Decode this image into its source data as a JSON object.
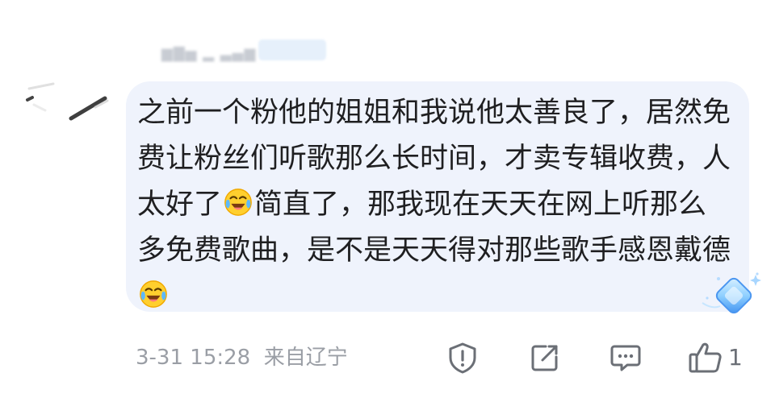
{
  "comment": {
    "text_before_emoji": "之前一个粉他的姐姐和我说他太善良了，居然免费让粉丝们听歌那么长时间，才卖专辑收费，人太好了",
    "text_after_emoji": "简直了，那我现在天天在网上听那么多免费歌曲，是不是天天得对那些歌手感恩戴德",
    "emoji_1": "laugh-cry-emoji",
    "emoji_2": "laugh-cry-emoji"
  },
  "meta": {
    "datetime": "3-31 15:28",
    "location": "来自辽宁"
  },
  "actions": {
    "report_icon": "shield-alert-icon",
    "share_icon": "share-edit-icon",
    "reply_icon": "comment-icon",
    "like_icon": "thumbs-up-icon",
    "like_count": "1"
  },
  "colors": {
    "bubble": "#eff3fc",
    "text": "#1f1f21",
    "meta": "#9a9ea5",
    "icon": "#6b6f76"
  }
}
